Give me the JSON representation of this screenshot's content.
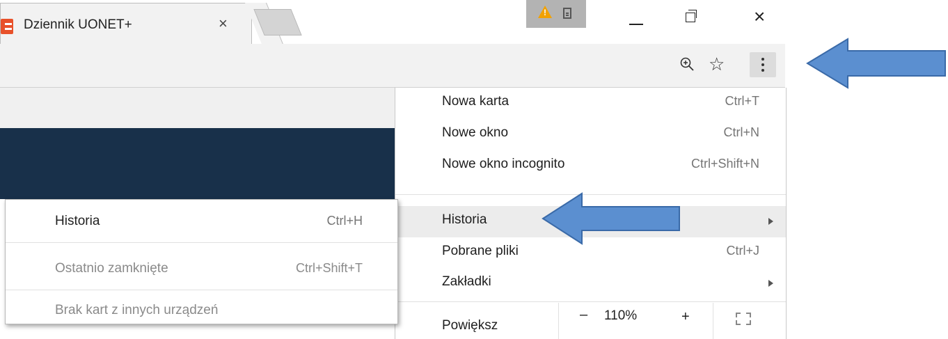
{
  "browser": {
    "tab": {
      "title": "Dziennik UONET+",
      "close_glyph": "×",
      "favicon": "uonet-logo-icon"
    },
    "window_controls": {
      "close_glyph": "×"
    },
    "toolbar": {
      "icons": [
        "zoom-icon",
        "star-icon",
        "menu-dots-icon"
      ]
    }
  },
  "main_menu": {
    "items": [
      {
        "label": "Nowa karta",
        "shortcut": "Ctrl+T"
      },
      {
        "label": "Nowe okno",
        "shortcut": "Ctrl+N"
      },
      {
        "label": "Nowe okno incognito",
        "shortcut": "Ctrl+Shift+N"
      },
      {
        "label": "Historia",
        "shortcut": "",
        "submenu": true
      },
      {
        "label": "Pobrane pliki",
        "shortcut": "Ctrl+J"
      },
      {
        "label": "Zakładki",
        "shortcut": "",
        "submenu": true
      }
    ],
    "zoom": {
      "label": "Powiększ",
      "minus": "–",
      "value": "110%",
      "plus": "+"
    }
  },
  "history_submenu": {
    "items": [
      {
        "label": "Historia",
        "shortcut": "Ctrl+H",
        "enabled": true
      },
      {
        "label": "Ostatnio zamknięte",
        "shortcut": "Ctrl+Shift+T",
        "enabled": false
      },
      {
        "label": "Brak kart z innych urządzeń",
        "shortcut": "",
        "enabled": false
      }
    ]
  },
  "annotations": {
    "arrow_color": "#5b8fd0",
    "arrow_stroke": "#3a6aa8"
  },
  "colors": {
    "page_header": "#18304a",
    "favicon": "#e8512a",
    "warning": "#f2a100"
  }
}
